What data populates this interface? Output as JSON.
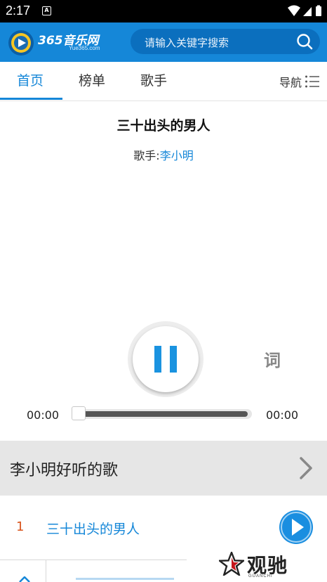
{
  "status_bar": {
    "time": "2:17",
    "notification_icon": "a-badge-icon",
    "icons": [
      "wifi-icon",
      "signal-icon",
      "battery-icon"
    ]
  },
  "header": {
    "logo_text": "365音乐网",
    "logo_sub": "Yue365.com",
    "search_placeholder": "请输入关键字搜索",
    "brand_color": "#1587d8"
  },
  "tabs": [
    {
      "label": "首页",
      "active": true
    },
    {
      "label": "榜单",
      "active": false
    },
    {
      "label": "歌手",
      "active": false
    }
  ],
  "nav_label": "导航",
  "song": {
    "title": "三十出头的男人",
    "singer_label": "歌手:",
    "singer": "李小明"
  },
  "player": {
    "state": "playing",
    "lyrics_label": "词",
    "current_time": "00:00",
    "total_time": "00:00",
    "progress": 0
  },
  "section": {
    "title": "李小明好听的歌"
  },
  "song_list": [
    {
      "index": "1",
      "name": "三十出头的男人"
    }
  ],
  "watermark": {
    "text": "观驰",
    "sub": "GUANCHI"
  }
}
